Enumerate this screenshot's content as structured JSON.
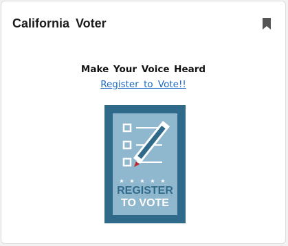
{
  "card": {
    "title": "California Voter",
    "bookmark_icon": "bookmark-icon"
  },
  "main": {
    "headline": "Make Your Voice Heard",
    "link_text": "Register to Vote!!"
  },
  "poster": {
    "line1": "REGISTER",
    "line2": "TO VOTE",
    "colors": {
      "border": "#2f6a8a",
      "fill": "#8fb7cd",
      "accent_red": "#c0272d"
    }
  }
}
